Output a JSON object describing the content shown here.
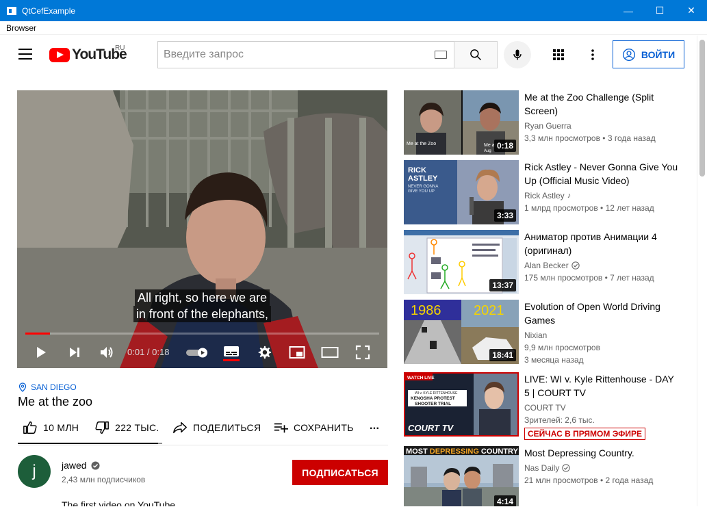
{
  "window": {
    "title": "QtCefExample",
    "minimize": "—",
    "maximize": "☐",
    "close": "✕",
    "menu": "Browser"
  },
  "masthead": {
    "logo_text": "YouTube",
    "region": "RU",
    "search_placeholder": "Введите запрос",
    "signin_label": "ВОЙТИ"
  },
  "player": {
    "caption_line1": "All right, so here we are",
    "caption_line2": "in front of the elephants,",
    "current_time": "0:01",
    "time_separator": " / ",
    "duration": "0:18",
    "progress_fraction": 0.07
  },
  "video": {
    "location": "SAN DIEGO",
    "title": "Me at the zoo",
    "likes": "10 МЛН",
    "dislikes": "222 ТЫС.",
    "share_label": "ПОДЕЛИТЬСЯ",
    "save_label": "СОХРАНИТЬ",
    "more": "...",
    "sentiment_fraction": 0.97
  },
  "owner": {
    "avatar_letter": "j",
    "name": "jawed",
    "subscribers": "2,43 млн подписчиков",
    "subscribe_label": "ПОДПИСАТЬСЯ",
    "description": "The first video on YouTube"
  },
  "related": [
    {
      "title": "Me at the Zoo Challenge (Split Screen)",
      "channel": "Ryan Guerra",
      "meta": "3,3 млн просмотров • 3 года назад",
      "duration": "0:18",
      "thumb_text_a": "Me at the Zoo",
      "thumb_text_b": "Me at",
      "thumb_text_c": "Aug"
    },
    {
      "title": "Rick Astley - Never Gonna Give You Up (Official Music Video)",
      "channel": "Rick Astley",
      "meta": "1 млрд просмотров • 12 лет назад",
      "duration": "3:33",
      "thumb_text_a": "RICK",
      "thumb_text_b": "ASTLEY",
      "thumb_text_c": "NEVER GONNA",
      "thumb_text_d": "GIVE YOU UP"
    },
    {
      "title": "Аниматор против Анимации 4 (оригинал)",
      "channel": "Alan Becker",
      "meta": "175 млн просмотров • 7 лет назад",
      "duration": "13:37"
    },
    {
      "title": "Evolution of Open World Driving Games",
      "channel": "Nixian",
      "meta": "9,9 млн просмотров",
      "meta2": "3 месяца назад",
      "duration": "18:41",
      "thumb_text_a": "1986",
      "thumb_text_b": "2021"
    },
    {
      "title": "LIVE: WI v. Kyle Rittenhouse - DAY 5 | COURT TV",
      "channel": "COURT TV",
      "meta": "Зрителей: 2,6 тыс.",
      "live_badge": "СЕЙЧАС В ПРЯМОМ ЭФИРЕ",
      "thumb_text_a": "WATCH LIVE",
      "thumb_text_b": "WI v. KYLE RITTENHOUSE",
      "thumb_text_c": "KENOSHA PROTEST",
      "thumb_text_d": "SHOOTER TRIAL",
      "thumb_text_e": "COURT TV"
    },
    {
      "title": "Most Depressing Country.",
      "channel": "Nas Daily",
      "meta": "21 млн просмотров • 2 года назад",
      "duration": "4:14",
      "thumb_text_a": "MOST",
      "thumb_text_b": "DEPRESSING",
      "thumb_text_c": "COUNTRY"
    }
  ],
  "colors": {
    "brand_red": "#ff0000",
    "link_blue": "#065fd4",
    "subscribe_red": "#cc0000",
    "titlebar_blue": "#0078d7"
  }
}
